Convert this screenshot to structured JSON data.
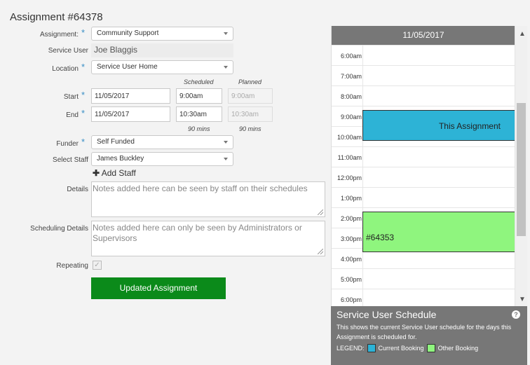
{
  "page": {
    "title": "Assignment #64378"
  },
  "form": {
    "assignment": {
      "label": "Assignment:",
      "value": "Community Support"
    },
    "service_user": {
      "label": "Service User",
      "value": "Joe Blaggis"
    },
    "location": {
      "label": "Location",
      "value": "Service User Home"
    },
    "columns": {
      "scheduled": "Scheduled",
      "planned": "Planned"
    },
    "start": {
      "label": "Start",
      "date": "11/05/2017",
      "scheduled": "9:00am",
      "planned": "9:00am"
    },
    "end": {
      "label": "End",
      "date": "11/05/2017",
      "scheduled": "10:30am",
      "planned": "10:30am"
    },
    "durations": {
      "scheduled": "90 mins",
      "planned": "90 mins"
    },
    "funder": {
      "label": "Funder",
      "value": "Self Funded"
    },
    "staff": {
      "label": "Select Staff",
      "value": "James Buckley"
    },
    "add_staff": "Add Staff",
    "details": {
      "label": "Details",
      "placeholder": "Notes added here can be seen by staff on their schedules"
    },
    "scheduling_details": {
      "label": "Scheduling Details",
      "placeholder": "Notes added here can only be seen by Administrators or Supervisors"
    },
    "repeating": {
      "label": "Repeating",
      "checked": true
    },
    "submit": "Updated Assignment",
    "required_mark": "*"
  },
  "calendar": {
    "date": "11/05/2017",
    "hours": [
      "6:00am",
      "7:00am",
      "8:00am",
      "9:00am",
      "10:00am",
      "11:00am",
      "12:00pm",
      "1:00pm",
      "2:00pm",
      "3:00pm",
      "4:00pm",
      "5:00pm",
      "6:00pm"
    ],
    "bookings": [
      {
        "label": "This Assignment",
        "type": "current",
        "start_hour": 9.0,
        "end_hour": 10.5
      },
      {
        "label": "#64353",
        "type": "other",
        "start_hour": 14.0,
        "end_hour": 16.0
      }
    ]
  },
  "schedule_panel": {
    "title": "Service User Schedule",
    "description": "This shows the current Service User schedule for the days this Assignment is scheduled for.",
    "legend_label": "LEGEND:",
    "legend_current": "Current Booking",
    "legend_other": "Other Booking",
    "help": "?"
  },
  "colors": {
    "current_booking": "#2db3d6",
    "other_booking": "#8ff57e",
    "submit": "#0b8a1a",
    "required": "#3a8fc6"
  }
}
